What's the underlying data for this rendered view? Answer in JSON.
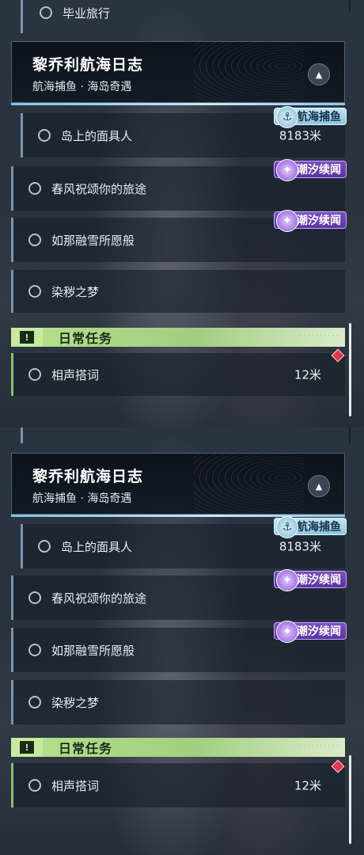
{
  "panels": [
    {
      "top_quest": {
        "label": "毕业旅行"
      },
      "header": {
        "title": "黎乔利航海日志",
        "subtitle": "航海捕鱼 · 海岛奇遇",
        "collapse_icon": "chevron-up-icon"
      },
      "quests": [
        {
          "label": "岛上的面具人",
          "distance": "8183米",
          "tag": "航海捕鱼"
        },
        {
          "label": "春风祝颂你的旅途",
          "distance": "",
          "tag": "潮汐续闻"
        },
        {
          "label": "如那融雪所愿般",
          "distance": "",
          "tag": "潮汐续闻"
        },
        {
          "label": "染秽之梦",
          "distance": "",
          "tag": ""
        }
      ],
      "daily": {
        "label": "日常任务",
        "quest": {
          "label": "相声搭词",
          "distance": "12米"
        }
      }
    },
    {
      "header": {
        "title": "黎乔利航海日志",
        "subtitle": "航海捕鱼 · 海岛奇遇",
        "collapse_icon": "chevron-up-icon"
      },
      "quests": [
        {
          "label": "岛上的面具人",
          "distance": "8183米",
          "tag": "航海捕鱼"
        },
        {
          "label": "春风祝颂你的旅途",
          "distance": "",
          "tag": "潮汐续闻"
        },
        {
          "label": "如那融雪所愿般",
          "distance": "",
          "tag": "潮汐续闻"
        },
        {
          "label": "染秽之梦",
          "distance": "",
          "tag": ""
        }
      ],
      "daily": {
        "label": "日常任务",
        "quest": {
          "label": "相声搭词",
          "distance": "12米"
        }
      }
    }
  ],
  "colors": {
    "daily_green": "#b6e28b",
    "tide_purple": "#6a3fb8",
    "fish_blue": "#a8d6ec",
    "marker_red": "#e2364f"
  }
}
